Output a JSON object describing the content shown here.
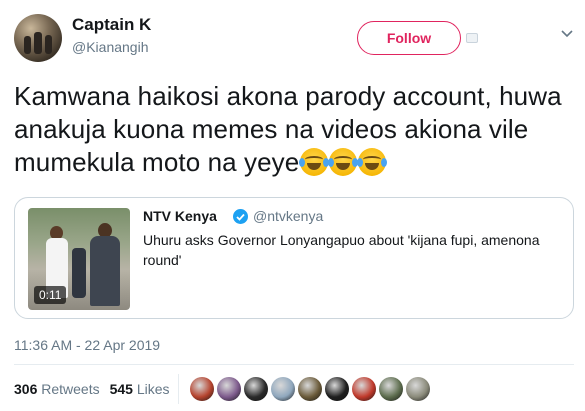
{
  "author": {
    "name": "Captain K",
    "handle": "@Kianangih"
  },
  "follow_label": "Follow",
  "tweet": {
    "text": "Kamwana haikosi akona parody account, huwa anakuja kuona memes na videos akiona vile mumekula moto na yeye",
    "emoji_count": 3,
    "timestamp": "11:36 AM - 22 Apr 2019"
  },
  "quote": {
    "name": "NTV Kenya",
    "handle": "@ntvkenya",
    "text": "Uhuru asks Governor Lonyangapuo about 'kijana fupi, amenona round'",
    "video_duration": "0:11"
  },
  "stats": {
    "retweets_count": "306",
    "retweets_label": "Retweets",
    "likes_count": "545",
    "likes_label": "Likes"
  },
  "colors": {
    "follow": "#e0245e",
    "verified": "#1da1f2",
    "muted": "#657786",
    "text": "#14171a"
  },
  "likers": [
    "#b5432e",
    "#7d5a8c",
    "#2a2a2a",
    "#8fa7bd",
    "#6b5b3a",
    "#1f1f1f",
    "#c0392b",
    "#5d6d4e",
    "#8a8a7a"
  ]
}
